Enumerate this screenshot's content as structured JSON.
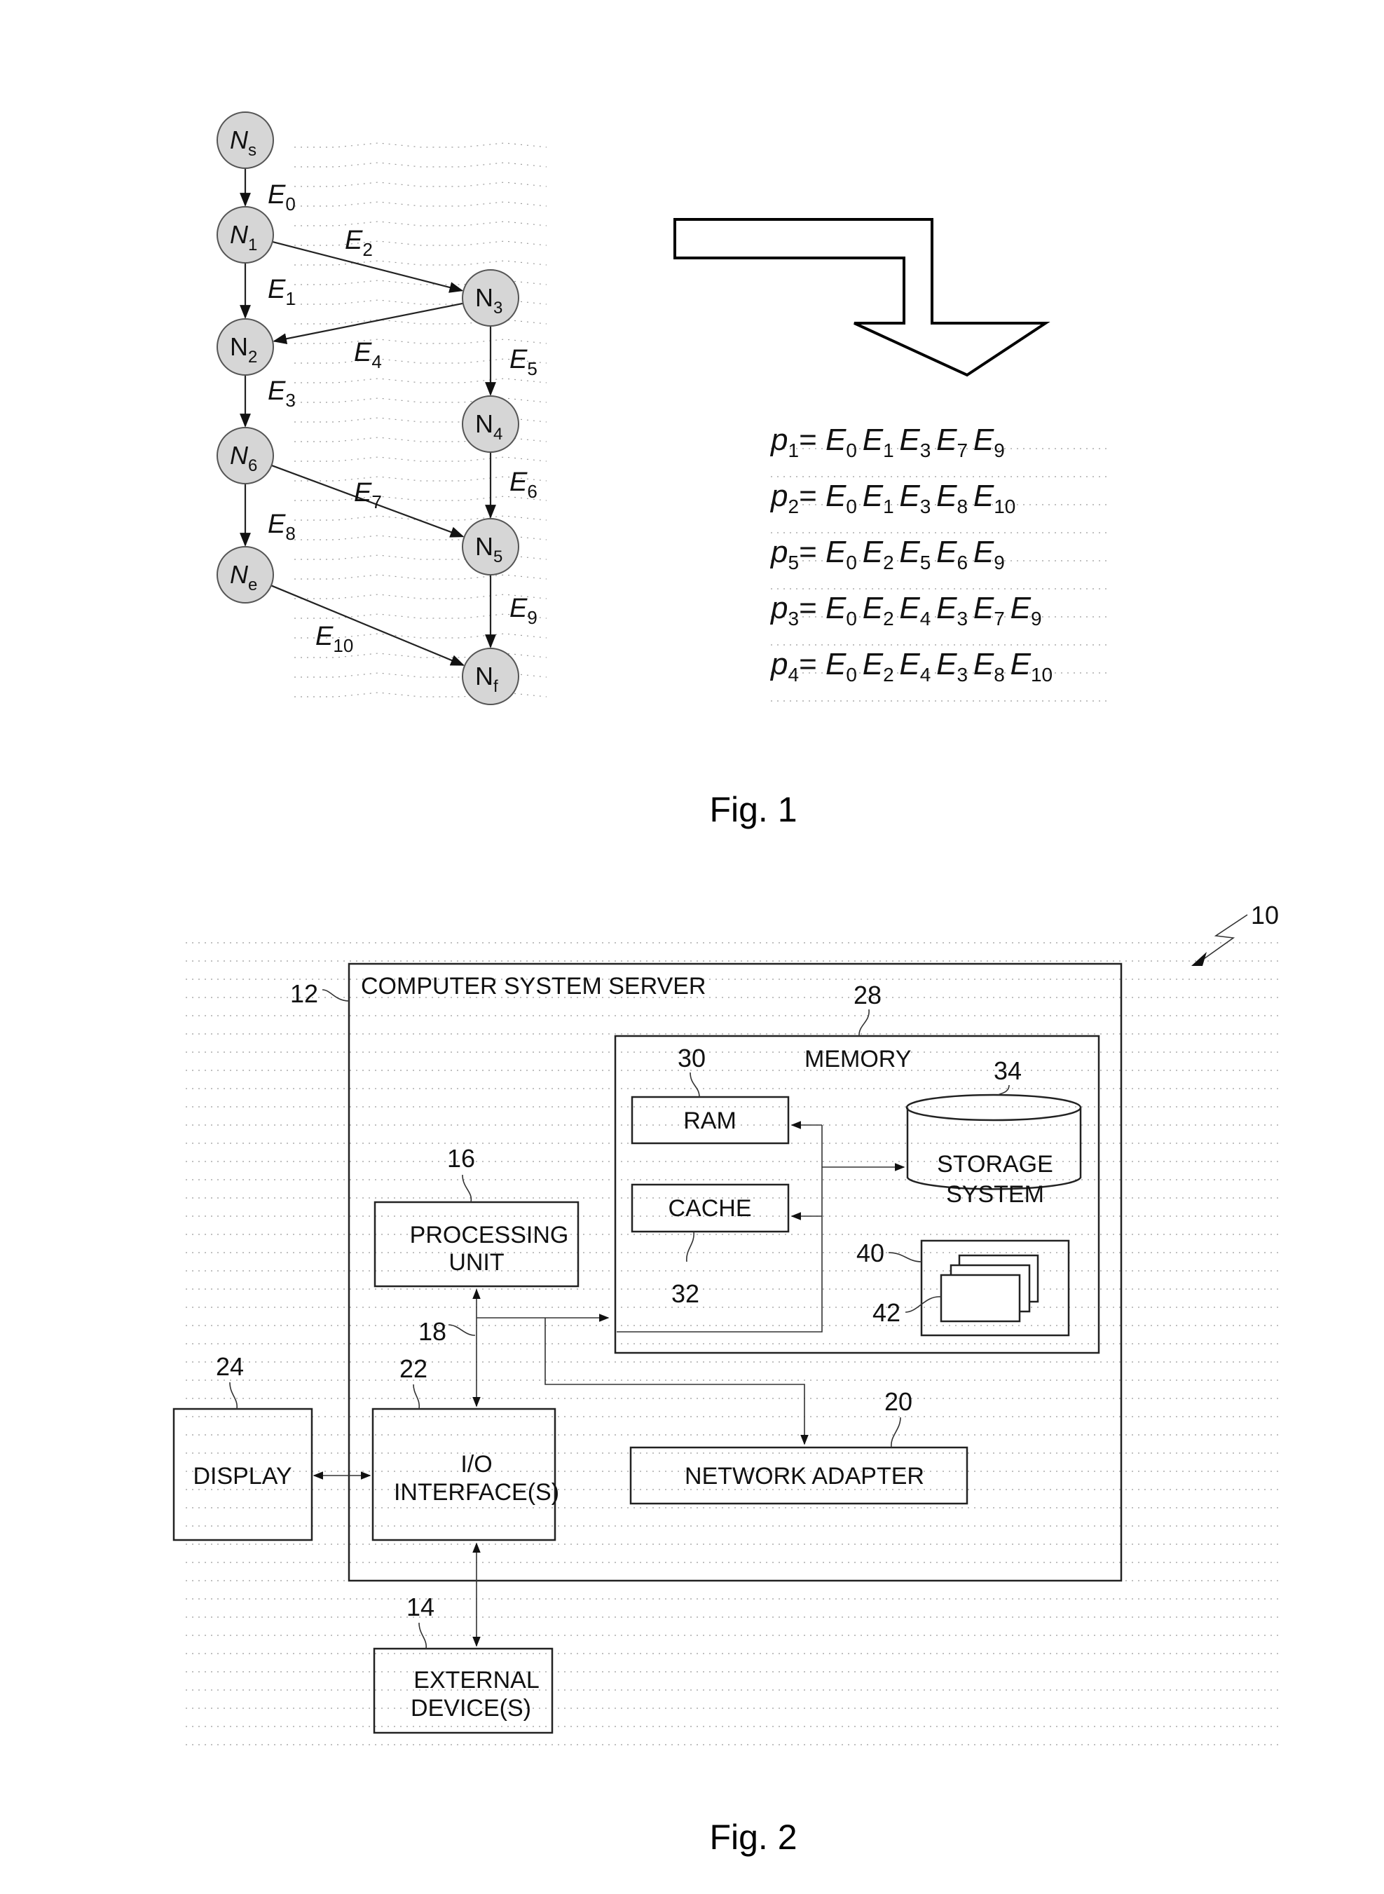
{
  "figure1": {
    "caption": "Fig. 1",
    "nodes": [
      {
        "id": "Ns",
        "base": "N",
        "sub": "s"
      },
      {
        "id": "N1",
        "base": "N",
        "sub": "1"
      },
      {
        "id": "N2",
        "base": "N",
        "sub": "2"
      },
      {
        "id": "N6",
        "base": "N",
        "sub": "6"
      },
      {
        "id": "Ne",
        "base": "N",
        "sub": "e"
      },
      {
        "id": "N3",
        "base": "N",
        "sub": "3"
      },
      {
        "id": "N4",
        "base": "N",
        "sub": "4"
      },
      {
        "id": "N5",
        "base": "N",
        "sub": "5"
      },
      {
        "id": "Nf",
        "base": "N",
        "sub": "f"
      }
    ],
    "edges": [
      {
        "id": "E0",
        "from": "Ns",
        "to": "N1",
        "base": "E",
        "sub": "0"
      },
      {
        "id": "E1",
        "from": "N1",
        "to": "N2",
        "base": "E",
        "sub": "1"
      },
      {
        "id": "E2",
        "from": "N1",
        "to": "N3",
        "base": "E",
        "sub": "2"
      },
      {
        "id": "E3",
        "from": "N2",
        "to": "N6",
        "base": "E",
        "sub": "3"
      },
      {
        "id": "E4",
        "from": "N3",
        "to": "N2",
        "base": "E",
        "sub": "4"
      },
      {
        "id": "E5",
        "from": "N3",
        "to": "N4",
        "base": "E",
        "sub": "5"
      },
      {
        "id": "E6",
        "from": "N4",
        "to": "N5",
        "base": "E",
        "sub": "6"
      },
      {
        "id": "E7",
        "from": "N6",
        "to": "N5",
        "base": "E",
        "sub": "7"
      },
      {
        "id": "E8",
        "from": "N6",
        "to": "Ne",
        "base": "E",
        "sub": "8"
      },
      {
        "id": "E9",
        "from": "N5",
        "to": "Nf",
        "base": "E",
        "sub": "9"
      },
      {
        "id": "E10",
        "from": "Ne",
        "to": "Nf",
        "base": "E",
        "sub": "10"
      }
    ],
    "paths": [
      {
        "name": "p",
        "index": "1",
        "edges": [
          "0",
          "1",
          "3",
          "7",
          "9"
        ]
      },
      {
        "name": "p",
        "index": "2",
        "edges": [
          "0",
          "1",
          "3",
          "8",
          "10"
        ]
      },
      {
        "name": "p",
        "index": "5",
        "edges": [
          "0",
          "2",
          "5",
          "6",
          "9"
        ]
      },
      {
        "name": "p",
        "index": "3",
        "edges": [
          "0",
          "2",
          "4",
          "3",
          "7",
          "9"
        ]
      },
      {
        "name": "p",
        "index": "4",
        "edges": [
          "0",
          "2",
          "4",
          "3",
          "8",
          "10"
        ]
      }
    ],
    "equals": "=",
    "edge_symbol": "E"
  },
  "figure2": {
    "caption": "Fig. 2",
    "system_ref": "10",
    "server": {
      "ref": "12",
      "label": "COMPUTER SYSTEM SERVER"
    },
    "memory": {
      "ref": "28",
      "label": "MEMORY"
    },
    "ram": {
      "ref": "30",
      "label": "RAM"
    },
    "cache": {
      "ref": "32",
      "label": "CACHE"
    },
    "storage": {
      "ref": "34",
      "label_line1": "STORAGE",
      "label_line2": "SYSTEM"
    },
    "program_modules": {
      "ref": "40",
      "module_ref": "42"
    },
    "processing_unit": {
      "ref": "16",
      "label_line1": "PROCESSING",
      "label_line2": "UNIT"
    },
    "bus": {
      "ref": "18"
    },
    "io_interfaces": {
      "ref": "22",
      "label_line1": "I/O",
      "label_line2": "INTERFACE(S)"
    },
    "network_adapter": {
      "ref": "20",
      "label": "NETWORK ADAPTER"
    },
    "display": {
      "ref": "24",
      "label": "DISPLAY"
    },
    "external_devices": {
      "ref": "14",
      "label_line1": "EXTERNAL",
      "label_line2": "DEVICE(S)"
    }
  }
}
